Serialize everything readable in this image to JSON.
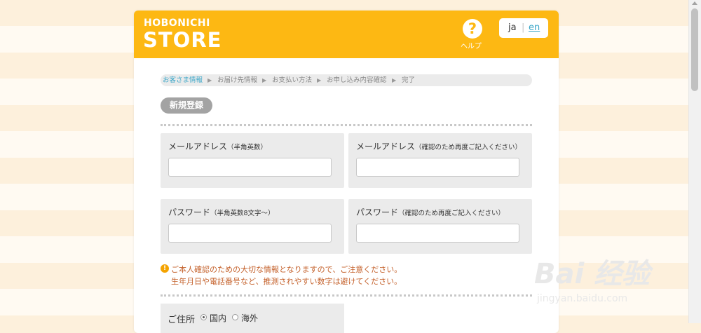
{
  "header": {
    "logo_top": "HOBONICHI",
    "logo_main": "STORE",
    "help_label": "ヘルプ",
    "lang_ja": "ja",
    "lang_sep": "|",
    "lang_en": "en",
    "brand_color": "#fdb813"
  },
  "breadcrumb": [
    "お客さま情報",
    "お届け先情報",
    "お支払い方法",
    "お申し込み内容確認",
    "完了"
  ],
  "breadcrumb_active_index": 0,
  "new_registration_label": "新規登録",
  "fields": {
    "email": {
      "label": "メールアドレス",
      "note": "（半角英数）",
      "value": ""
    },
    "email_confirm": {
      "label": "メールアドレス",
      "note": "（確認のため再度ご記入ください）",
      "value": ""
    },
    "password": {
      "label": "パスワード",
      "note": "（半角英数8文字〜）",
      "value": ""
    },
    "password_confirm": {
      "label": "パスワード",
      "note": "（確認のため再度ご記入ください）",
      "value": ""
    }
  },
  "warning": {
    "line1": "ご本人確認のための大切な情報となりますので、ご注意ください。",
    "line2": "生年月日や電話番号など、推測されやすい数字は避けてください。"
  },
  "address": {
    "label": "ご住所",
    "options": [
      "国内",
      "海外"
    ],
    "selected": "国内"
  },
  "watermark": {
    "main": "Bai 经验",
    "sub": "jingyan.baidu.com"
  }
}
